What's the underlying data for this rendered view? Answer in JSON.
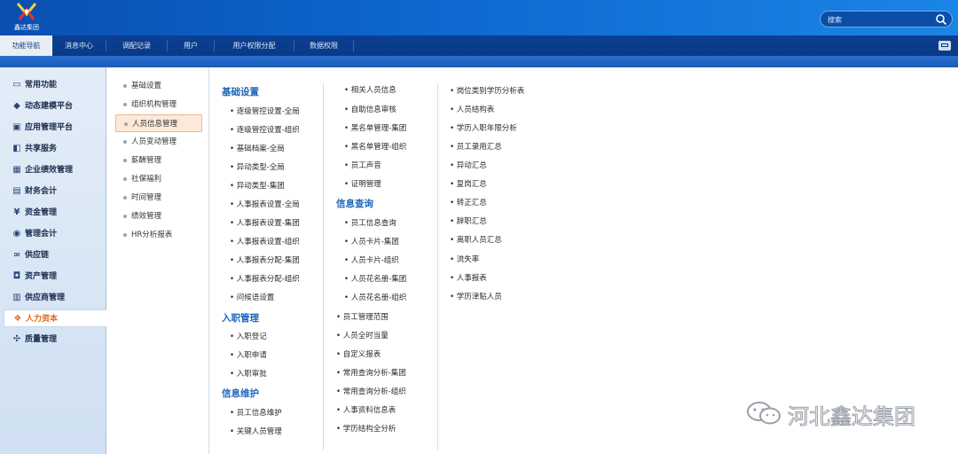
{
  "header": {
    "logo_text": "鑫达集团",
    "search_placeholder": "搜索"
  },
  "tabs": [
    {
      "label": "功能导航",
      "active": true
    },
    {
      "label": "消息中心"
    },
    {
      "label": "调配记录"
    },
    {
      "label": "用户"
    },
    {
      "label": "用户权限分配"
    },
    {
      "label": "数据权限"
    }
  ],
  "sidebar": {
    "items": [
      {
        "label": "常用功能",
        "icon": "monitor-icon"
      },
      {
        "label": "动态建模平台",
        "icon": "cube-icon"
      },
      {
        "label": "应用管理平台",
        "icon": "window-icon"
      },
      {
        "label": "共享服务",
        "icon": "share-icon"
      },
      {
        "label": "企业绩效管理",
        "icon": "grid-icon"
      },
      {
        "label": "财务会计",
        "icon": "ledger-icon"
      },
      {
        "label": "资金管理",
        "icon": "yen-icon"
      },
      {
        "label": "管理会计",
        "icon": "chart-icon"
      },
      {
        "label": "供应链",
        "icon": "link-icon"
      },
      {
        "label": "资产管理",
        "icon": "asset-icon"
      },
      {
        "label": "供应商管理",
        "icon": "supplier-icon"
      },
      {
        "label": "人力资本",
        "icon": "people-icon",
        "active": true
      },
      {
        "label": "质量管理",
        "icon": "quality-icon"
      }
    ]
  },
  "submenu": {
    "items": [
      {
        "label": "基础设置"
      },
      {
        "label": "组织机构管理"
      },
      {
        "label": "人员信息管理",
        "active": true
      },
      {
        "label": "人员变动管理"
      },
      {
        "label": "薪酬管理"
      },
      {
        "label": "社保福利"
      },
      {
        "label": "时间管理"
      },
      {
        "label": "绩效管理"
      },
      {
        "label": "HR分析报表"
      }
    ]
  },
  "columns": {
    "col1": {
      "basic_heading": "基础设置",
      "basic_items": [
        "逐级管控设置-全局",
        "逐级管控设置-组织",
        "基础档案-全局",
        "异动类型-全局",
        "异动类型-集团",
        "人事报表设置-全局",
        "人事报表设置-集团",
        "人事报表设置-组织",
        "人事报表分配-集团",
        "人事报表分配-组织",
        "问候语设置"
      ],
      "entry_heading": "入职管理",
      "entry_items": [
        "入职登记",
        "入职申请",
        "入职审批"
      ],
      "maint_heading": "信息维护",
      "maint_items": [
        "员工信息维护",
        "关键人员管理"
      ]
    },
    "col2": {
      "top_items": [
        "相关人员信息",
        "自助信息审核",
        "黑名单管理-集团",
        "黑名单管理-组织",
        "员工声音",
        "证明管理"
      ],
      "query_heading": "信息查询",
      "query_items": [
        "员工信息查询",
        "人员卡片-集团",
        "人员卡片-组织",
        "人员花名册-集团",
        "人员花名册-组织"
      ],
      "bottom_items": [
        "员工管理范围",
        "人员全时当量",
        "自定义报表",
        "常用查询分析-集团",
        "常用查询分析-组织",
        "人事资料信息表",
        "学历结构全分析"
      ]
    },
    "col3": {
      "items": [
        "岗位类别学历分析表",
        "人员结构表",
        "学历入职年限分析",
        "员工录用汇总",
        "异动汇总",
        "复岗汇总",
        "转正汇总",
        "辞职汇总",
        "离职人员汇总",
        "流失率",
        "人事报表",
        "学历津贴人员"
      ]
    }
  },
  "watermark": {
    "text": "河北鑫达集团"
  },
  "colors": {
    "header_blue": "#0d68cf",
    "tabbar_navy": "#0a3a86",
    "heading_blue": "#1d64b8",
    "active_orange": "#e0681d"
  }
}
